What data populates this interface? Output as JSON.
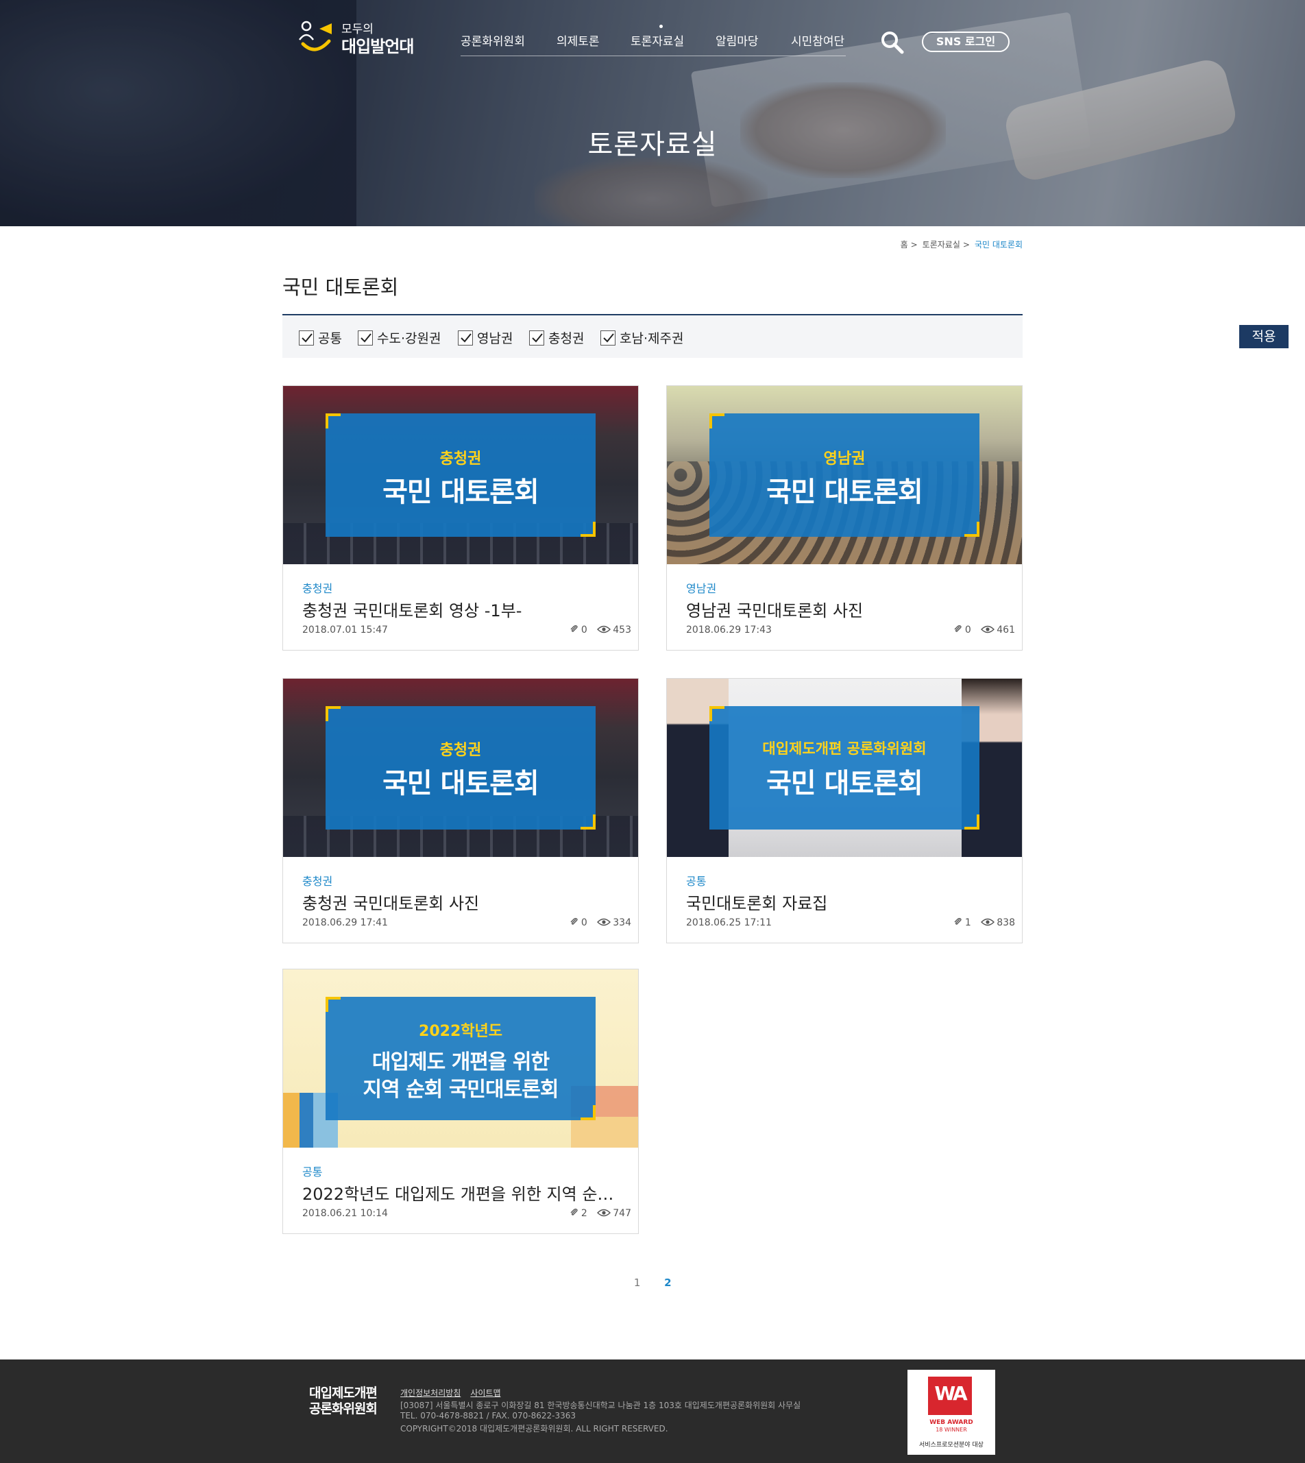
{
  "header": {
    "logo_small": "모두의",
    "logo_big": "대입발언대",
    "nav": [
      "공론화위원회",
      "의제토론",
      "토론자료실",
      "알림마당",
      "시민참여단"
    ],
    "sns_login": "SNS 로그인",
    "hero_title": "토론자료실"
  },
  "breadcrumb": [
    "홈",
    "토론자료실",
    "국민 대토론회"
  ],
  "page_title": "국민 대토론회",
  "filter": {
    "options": [
      "공통",
      "수도·강원권",
      "영남권",
      "충청권",
      "호남·제주권"
    ],
    "apply": "적용"
  },
  "cards": [
    {
      "category": "충청권",
      "title": "충청권 국민대토론회 영상 -1부-",
      "date": "2018.07.01 15:47",
      "attachments": "0",
      "views": "453",
      "banner_sub": "충청권",
      "banner_main": "국민 대토론회"
    },
    {
      "category": "영남권",
      "title": "영남권 국민대토론회 사진",
      "date": "2018.06.29 17:43",
      "attachments": "0",
      "views": "461",
      "banner_sub": "영남권",
      "banner_main": "국민 대토론회"
    },
    {
      "category": "충청권",
      "title": "충청권 국민대토론회 사진",
      "date": "2018.06.29 17:41",
      "attachments": "0",
      "views": "334",
      "banner_sub": "충청권",
      "banner_main": "국민 대토론회"
    },
    {
      "category": "공통",
      "title": "국민대토론회 자료집",
      "date": "2018.06.25 17:11",
      "attachments": "1",
      "views": "838",
      "banner_sub": "대입제도개편 공론화위원회",
      "banner_main": "국민 대토론회"
    },
    {
      "category": "공통",
      "title": "2022학년도 대입제도 개편을 위한 지역 순…",
      "date": "2018.06.21 10:14",
      "attachments": "2",
      "views": "747",
      "banner_sub": "2022학년도",
      "banner_main": "대입제도 개편을 위한",
      "banner_main2": "지역 순회 국민대토론회"
    }
  ],
  "pagination": [
    "1",
    "2"
  ],
  "footer": {
    "logo_line1": "대입제도개편",
    "logo_line2": "공론화위원회",
    "links": [
      "개인정보처리방침",
      "사이트맵"
    ],
    "address": "[03087] 서울특별시 종로구 이화장길 81 한국방송통신대학교 나눔관 1층 103호 대입제도개편공론화위원회 사무실",
    "contact": "TEL. 070-4678-8821 / FAX. 070-8622-3363",
    "copyright": "COPYRIGHT©2018 대입제도개편공론화위원회. ALL RIGHT RESERVED.",
    "award_logo": "WA",
    "award_line1": "WEB AWARD",
    "award_line2": "18 WINNER",
    "award_line3": "서비스프로모션분야 대상"
  },
  "colors": {
    "accent": "#1e88c9",
    "navy": "#1c3a63",
    "banner_blue": "#1578c3",
    "yellow": "#f6c400"
  }
}
